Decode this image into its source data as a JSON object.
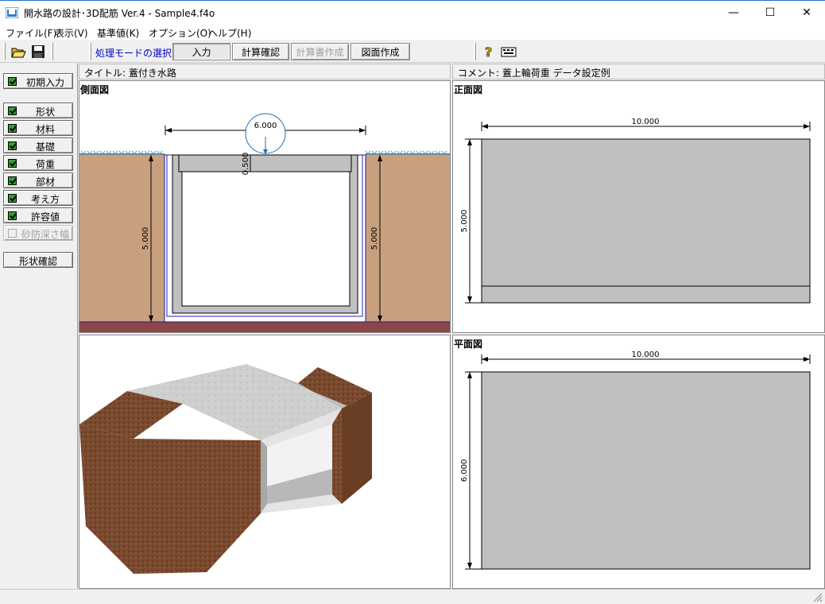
{
  "window": {
    "title": "開水路の設計･3D配筋 Ver.4 - Sample4.f4o",
    "min": "—",
    "max": "☐",
    "close": "✕"
  },
  "menu": [
    "ファイル(F)",
    "表示(V)",
    "基準値(K)",
    "オプション(O)",
    "ヘルプ(H)"
  ],
  "toolbar": {
    "mode_label": "処理モードの選択",
    "modes": [
      {
        "label": "入力",
        "state": "active"
      },
      {
        "label": "計算確認",
        "state": "normal"
      },
      {
        "label": "計算書作成",
        "state": "disabled"
      },
      {
        "label": "図面作成",
        "state": "normal"
      }
    ],
    "icons": [
      "open-folder-icon",
      "save-disk-icon",
      "help-icon",
      "keyboard-icon"
    ]
  },
  "left_panel": {
    "initial": "初期入力",
    "items": [
      "形状",
      "材料",
      "基礎",
      "荷重",
      "部材",
      "考え方",
      "許容値"
    ],
    "disabled_item": "砂防深さ幅",
    "check_shape": "形状確認"
  },
  "info": {
    "title_label": "タイトル:",
    "title_value": "蓋付き水路",
    "comment_label": "コメント:",
    "comment_value": "蓋上輪荷重 データ設定例"
  },
  "views": {
    "side": {
      "title": "側面図",
      "width_dim": "6.000",
      "cover_dim": "0.500",
      "left_height": "5.000",
      "right_height": "5.000"
    },
    "front": {
      "title": "正面図",
      "width_dim": "10.000",
      "height_dim": "5.000"
    },
    "plan": {
      "title": "平面図",
      "width_dim": "10.000",
      "height_dim": "6.000"
    }
  },
  "colors": {
    "soil": "#c9a07e",
    "bedrock": "#8b4648",
    "concrete": "#c0c0c0",
    "rebar_line": "#2020c0",
    "water_mark": "#2a9fd6",
    "dim_circle": "#1f6fb0"
  }
}
